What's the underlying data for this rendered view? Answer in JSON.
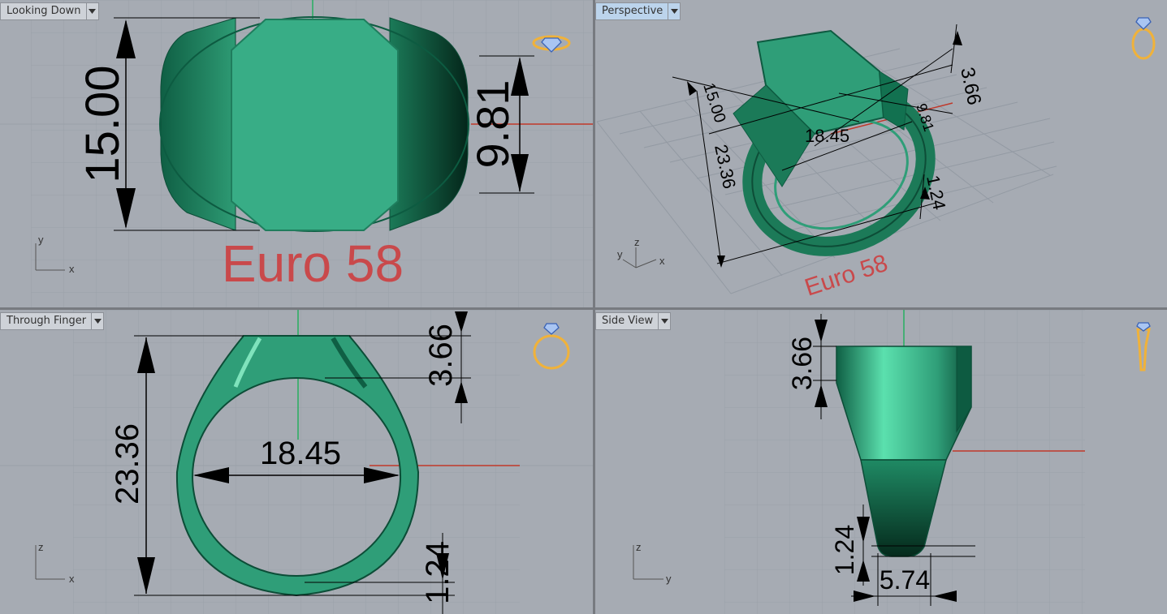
{
  "viewports": {
    "top": {
      "label": "Looking Down",
      "dims": {
        "height": "15.00",
        "width": "9.81"
      },
      "size_label": "Euro 58"
    },
    "perspective": {
      "label": "Perspective",
      "dims": {
        "top_h": "3.66",
        "length": "15.00",
        "width": "9.81",
        "inner": "18.45",
        "height": "23.36",
        "band": "1.24"
      },
      "size_label": "Euro 58"
    },
    "front": {
      "label": "Through Finger",
      "dims": {
        "height": "23.36",
        "inner": "18.45",
        "top_h": "3.66",
        "band": "1.24"
      }
    },
    "side": {
      "label": "Side View",
      "dims": {
        "top_h": "3.66",
        "band": "1.24",
        "width": "5.74"
      }
    }
  },
  "axes": {
    "x": "x",
    "y": "y",
    "z": "z"
  },
  "icons": [
    "ring-diamond-top-icon",
    "ring-perspective-icon",
    "ring-front-icon",
    "ring-side-icon",
    "dropdown-arrow-icon"
  ],
  "colors": {
    "viewport_bg": "#a6abb3",
    "grid": "#939aa3",
    "model": "#2f9e78",
    "accent_text": "#c9494b",
    "axis_x": "#c0392b",
    "axis_y": "#27ae60",
    "active_tab": "#bcd4ec"
  }
}
